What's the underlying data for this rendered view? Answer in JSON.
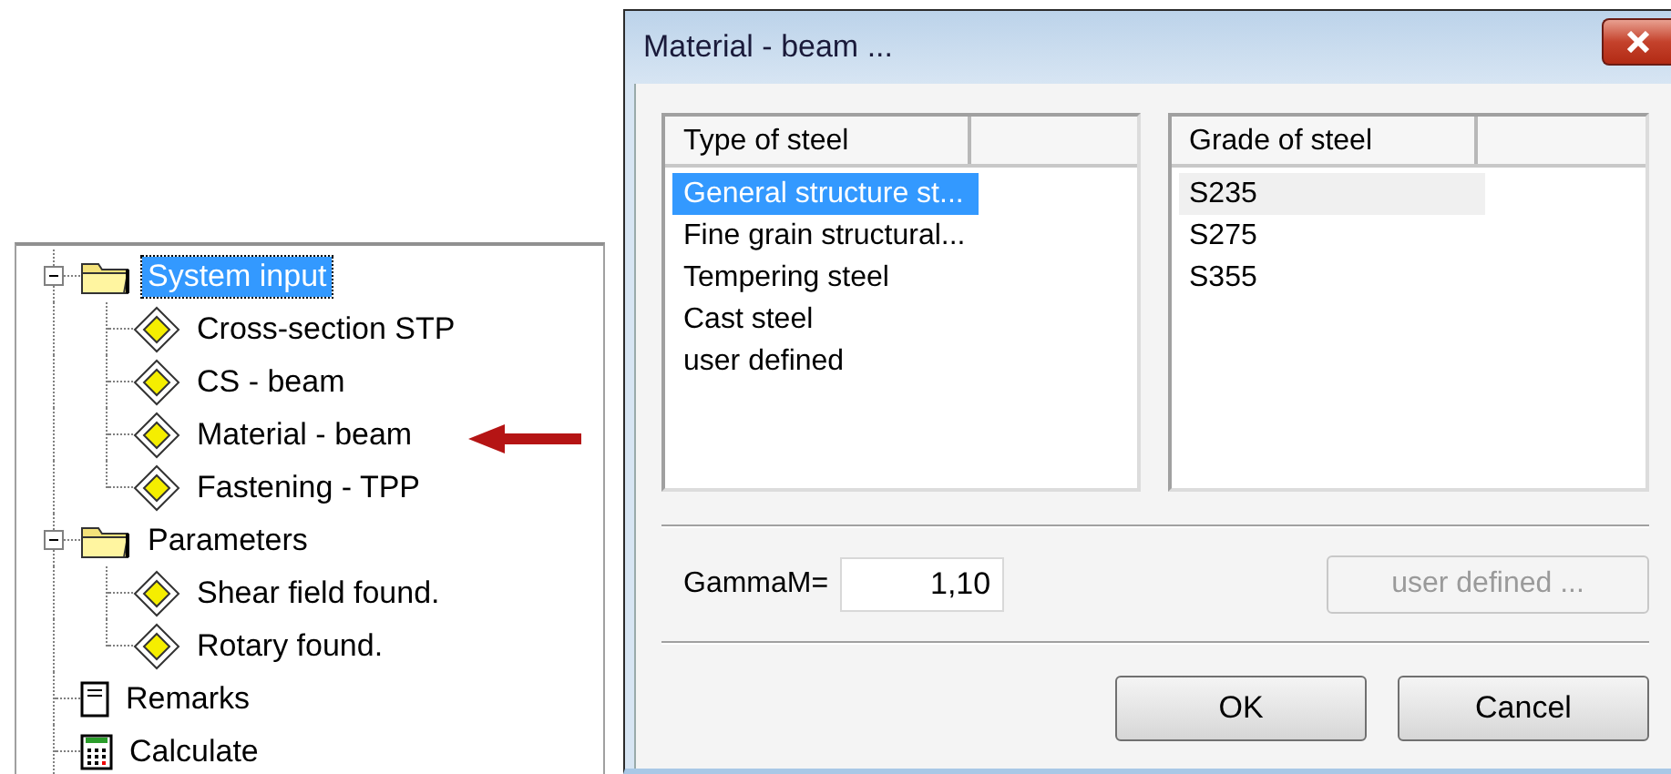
{
  "tree": [
    {
      "label": "System input",
      "kind": "folder",
      "expanded": true,
      "selected": true,
      "children": [
        {
          "label": "Cross-section STP",
          "kind": "item",
          "selected": false
        },
        {
          "label": "CS - beam",
          "kind": "item",
          "selected": false
        },
        {
          "label": "Material - beam",
          "kind": "item",
          "selected": false,
          "pointer": true
        },
        {
          "label": "Fastening - TPP",
          "kind": "item",
          "selected": false
        }
      ]
    },
    {
      "label": "Parameters",
      "kind": "folder",
      "expanded": true,
      "selected": false,
      "children": [
        {
          "label": "Shear field found.",
          "kind": "item",
          "selected": false
        },
        {
          "label": "Rotary found.",
          "kind": "item",
          "selected": false
        }
      ]
    },
    {
      "label": "Remarks",
      "kind": "document",
      "selected": false
    },
    {
      "label": "Calculate",
      "kind": "calculator",
      "selected": false
    }
  ],
  "dialog": {
    "title": "Material - beam ...",
    "lists": [
      {
        "header": "Type of steel",
        "focused": true,
        "items": [
          {
            "label": "General structure st...",
            "selected": true
          },
          {
            "label": "Fine grain structural...",
            "selected": false
          },
          {
            "label": "Tempering steel",
            "selected": false
          },
          {
            "label": "Cast steel",
            "selected": false
          },
          {
            "label": "user defined",
            "selected": false
          }
        ]
      },
      {
        "header": "Grade of steel",
        "focused": false,
        "items": [
          {
            "label": "S235",
            "selected": true
          },
          {
            "label": "S275",
            "selected": false
          },
          {
            "label": "S355",
            "selected": false
          }
        ]
      }
    ],
    "gamma": {
      "label": "GammaM=",
      "value": "1,10"
    },
    "user_defined_button": {
      "label": "user defined ...",
      "disabled": true
    },
    "buttons": [
      {
        "label": "OK"
      },
      {
        "label": "Cancel"
      }
    ]
  }
}
